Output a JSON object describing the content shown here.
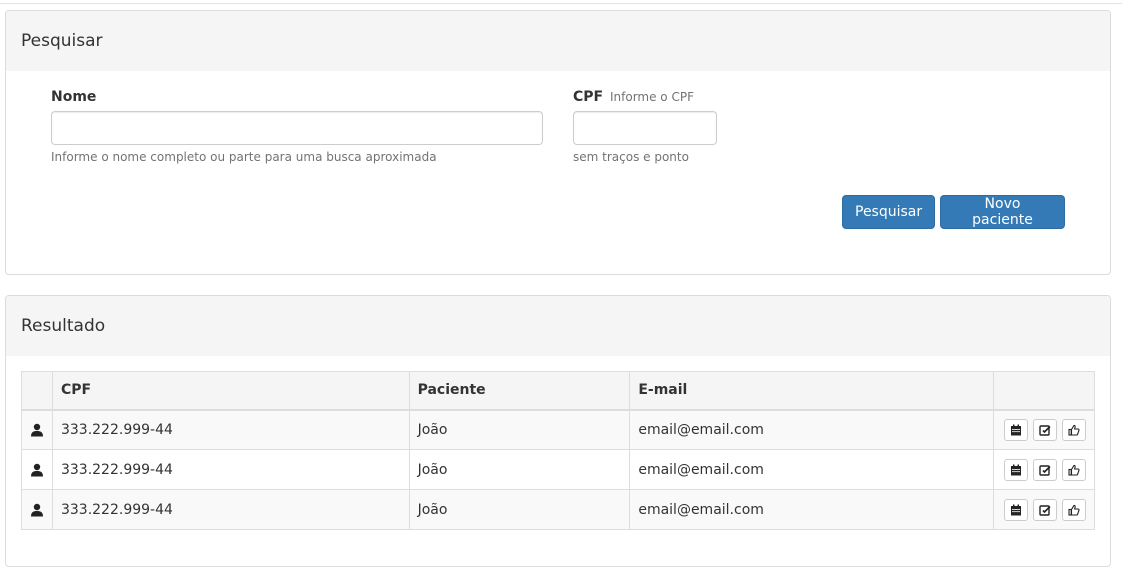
{
  "search_panel": {
    "title": "Pesquisar",
    "nome_label": "Nome",
    "nome_value": "",
    "nome_help": "Informe o nome completo ou parte para uma busca aproximada",
    "cpf_label": "CPF",
    "cpf_hint": "Informe o CPF",
    "cpf_value": "",
    "cpf_help": "sem traços e ponto",
    "search_button": "Pesquisar",
    "new_button": "Novo paciente"
  },
  "result_panel": {
    "title": "Resultado",
    "columns": [
      "",
      "CPF",
      "Paciente",
      "E-mail",
      ""
    ],
    "rows": [
      {
        "cpf": "333.222.999-44",
        "paciente": "João",
        "email": "email@email.com"
      },
      {
        "cpf": "333.222.999-44",
        "paciente": "João",
        "email": "email@email.com"
      },
      {
        "cpf": "333.222.999-44",
        "paciente": "João",
        "email": "email@email.com"
      }
    ],
    "row_icon": "user-icon",
    "action_icons": [
      "calendar-icon",
      "edit-icon",
      "thumbs-up-icon"
    ]
  },
  "colors": {
    "primary": "#337ab7",
    "panel_heading": "#f5f5f5",
    "border": "#dddddd"
  }
}
